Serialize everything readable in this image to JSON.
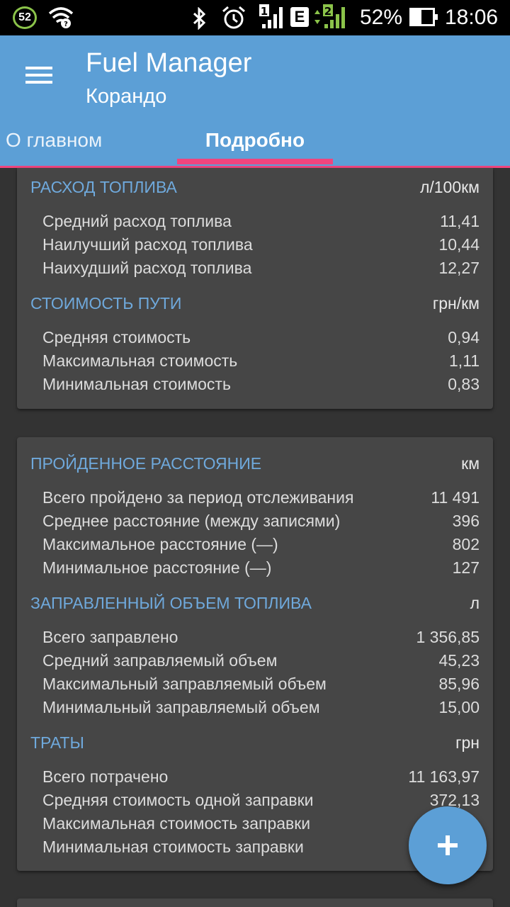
{
  "status_bar": {
    "notification_badge": "52",
    "battery_percent": "52%",
    "time": "18:06",
    "signal1_label": "1",
    "network_type": "E",
    "signal2_label": "2",
    "icons": [
      "wifi-question-icon",
      "bluetooth-icon",
      "alarm-icon",
      "signal-icon",
      "battery-icon"
    ]
  },
  "app_bar": {
    "title": "Fuel Manager",
    "subtitle": "Корандо",
    "tabs": [
      {
        "label": "О главном",
        "active": false
      },
      {
        "label": "Подробно",
        "active": true
      }
    ],
    "accent_color": "#5c9fd6",
    "indicator_color": "#f0457e"
  },
  "cards": [
    {
      "sections": [
        {
          "title": "РАСХОД ТОПЛИВА",
          "unit": "л/100км",
          "rows": [
            {
              "label": "Средний расход топлива",
              "value": "11,41"
            },
            {
              "label": "Наилучший расход топлива",
              "value": "10,44"
            },
            {
              "label": "Наихудший расход топлива",
              "value": "12,27"
            }
          ]
        },
        {
          "title": "СТОИМОСТЬ ПУТИ",
          "unit": "грн/км",
          "rows": [
            {
              "label": "Средняя стоимость",
              "value": "0,94"
            },
            {
              "label": "Максимальная стоимость",
              "value": "1,11"
            },
            {
              "label": "Минимальная стоимость",
              "value": "0,83"
            }
          ]
        }
      ]
    },
    {
      "sections": [
        {
          "title": "ПРОЙДЕННОЕ РАССТОЯНИЕ",
          "unit": "км",
          "rows": [
            {
              "label": "Всего пройдено за период отслеживания",
              "value": "11 491"
            },
            {
              "label": "Среднее расстояние (между записями)",
              "value": "396"
            },
            {
              "label": "Максимальное расстояние (—)",
              "value": "802"
            },
            {
              "label": "Минимальное расстояние (—)",
              "value": "127"
            }
          ]
        },
        {
          "title": "ЗАПРАВЛЕННЫЙ ОБЪЕМ ТОПЛИВА",
          "unit": "л",
          "rows": [
            {
              "label": "Всего заправлено",
              "value": "1 356,85"
            },
            {
              "label": "Средний заправляемый объем",
              "value": "45,23"
            },
            {
              "label": "Максимальный заправляемый объем",
              "value": "85,96"
            },
            {
              "label": "Минимальный заправляемый объем",
              "value": "15,00"
            }
          ]
        },
        {
          "title": "ТРАТЫ",
          "unit": "грн",
          "rows": [
            {
              "label": "Всего потрачено",
              "value": "11 163,97"
            },
            {
              "label": "Средняя стоимость одной заправки",
              "value": "372,13"
            },
            {
              "label": "Максимальная стоимость заправки",
              "value": ""
            },
            {
              "label": "Минимальная стоимость заправки",
              "value": ""
            }
          ]
        }
      ]
    }
  ],
  "fab": {
    "icon": "plus-icon"
  }
}
